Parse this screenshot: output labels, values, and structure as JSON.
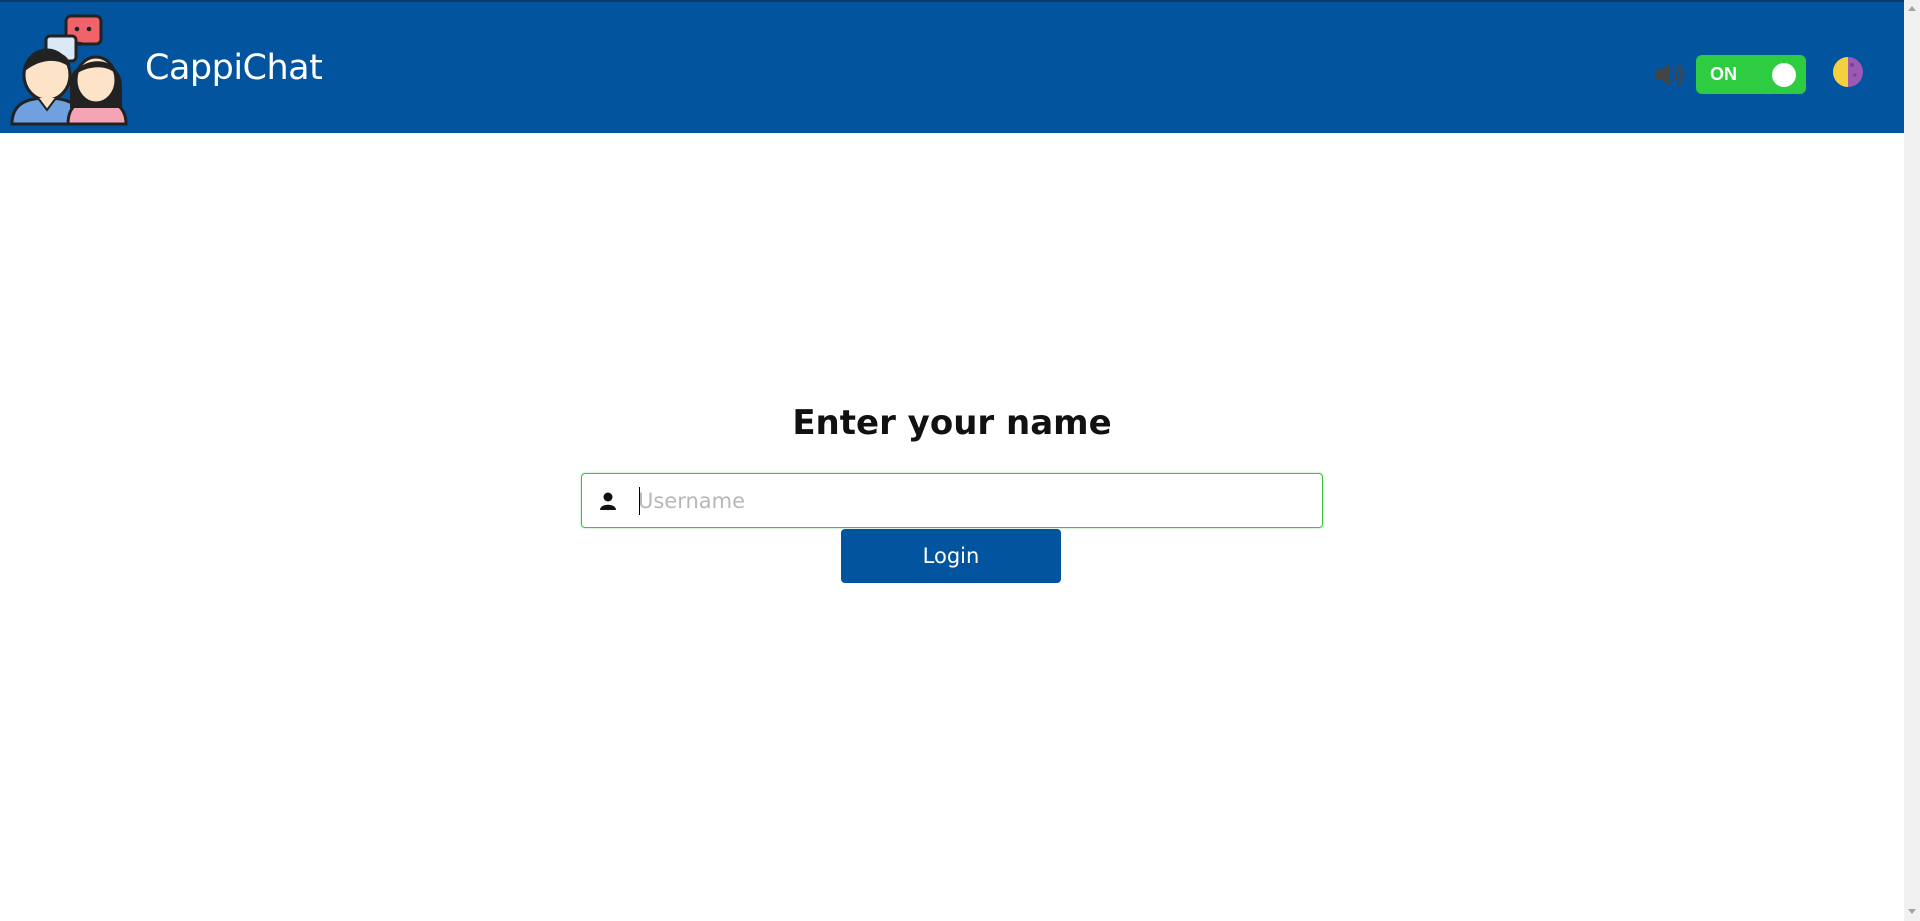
{
  "header": {
    "app_title": "CappiChat",
    "logo_icon": "two-people-chat-logo-icon",
    "speaker_icon": "speaker-icon",
    "sound_toggle_label": "ON",
    "sound_toggle_state": "on",
    "theme_icon": "half-moon-theme-icon"
  },
  "login": {
    "title": "Enter your name",
    "username_placeholder": "Username",
    "username_value": "",
    "user_icon": "user-icon",
    "button_label": "Login"
  },
  "colors": {
    "primary": "#03549f",
    "toggle_on": "#2ecc40",
    "input_focus_border": "#3bc24a",
    "background": "#ffffff"
  }
}
